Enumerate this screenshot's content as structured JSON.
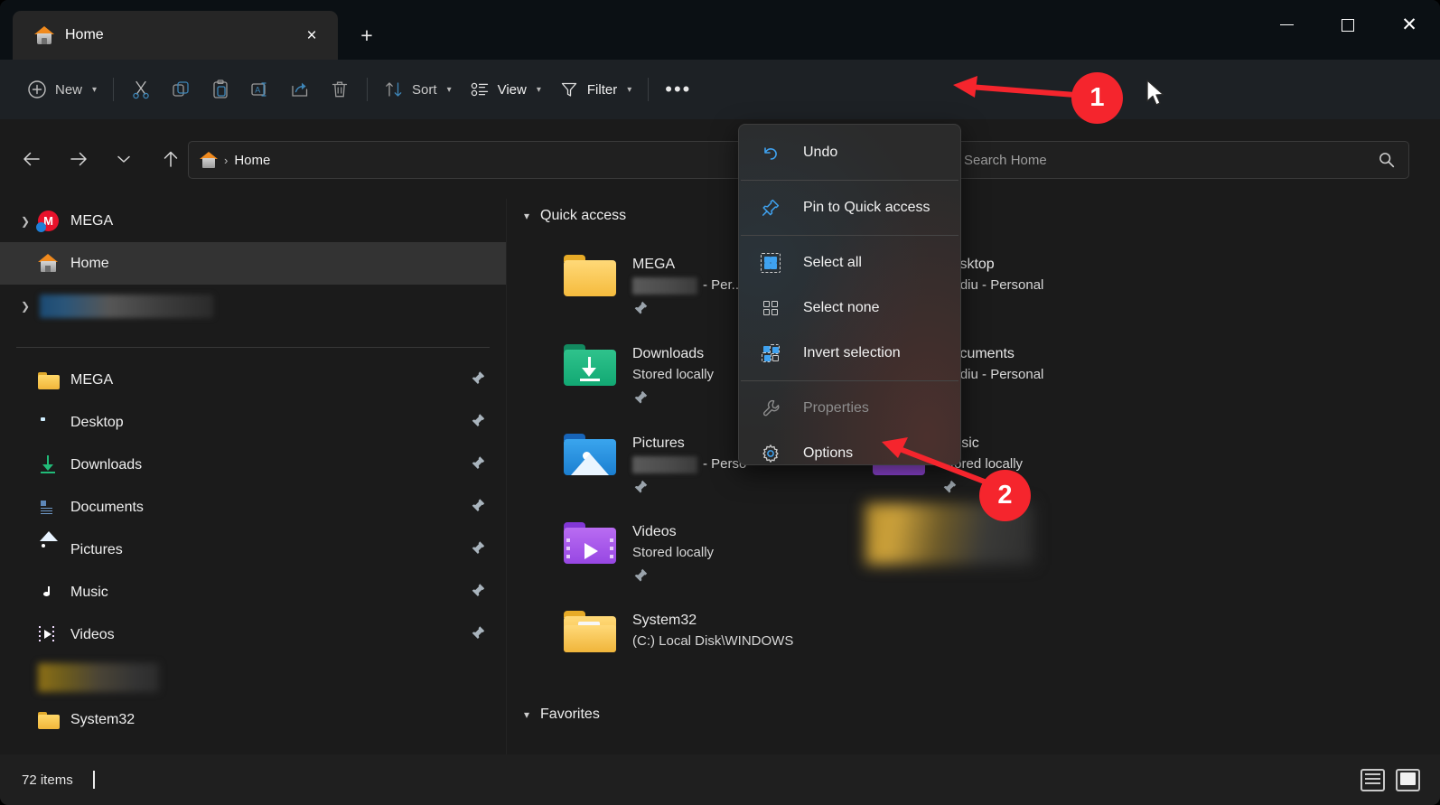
{
  "window": {
    "title": "Home",
    "controls": {
      "minimize": "minimize-button",
      "maximize": "maximize-button",
      "close": "close-button"
    },
    "new_tab_label": "+",
    "tab_close_label": "×"
  },
  "toolbar": {
    "new_label": "New",
    "cut_label": "Cut",
    "copy_label": "Copy",
    "paste_label": "Paste",
    "rename_label": "Rename",
    "share_label": "Share",
    "delete_label": "Delete",
    "sort_label": "Sort",
    "view_label": "View",
    "filter_label": "Filter",
    "more_label": "•••"
  },
  "addressbar": {
    "back": "Back",
    "forward": "Forward",
    "recent": "Recent locations",
    "up": "Up to parent",
    "breadcrumb_root": "Home",
    "breadcrumb_separator": "›"
  },
  "search": {
    "placeholder": "Search Home"
  },
  "sidebar": {
    "tree": [
      {
        "label": "MEGA",
        "icon": "mega-icon",
        "expandable": true,
        "selected": false
      },
      {
        "label": "Home",
        "icon": "home-icon",
        "expandable": false,
        "selected": true
      },
      {
        "label": "",
        "icon": "blurred-account-icon",
        "expandable": true,
        "selected": false,
        "blurred": true
      }
    ],
    "pinned": [
      {
        "label": "MEGA",
        "icon": "folder-icon",
        "pinned": true
      },
      {
        "label": "Desktop",
        "icon": "desktop-icon",
        "pinned": true
      },
      {
        "label": "Downloads",
        "icon": "downloads-icon",
        "pinned": true
      },
      {
        "label": "Documents",
        "icon": "documents-icon",
        "pinned": true
      },
      {
        "label": "Pictures",
        "icon": "pictures-icon",
        "pinned": true
      },
      {
        "label": "Music",
        "icon": "music-icon",
        "pinned": true
      },
      {
        "label": "Videos",
        "icon": "videos-icon",
        "pinned": true
      },
      {
        "label": "",
        "icon": "blurred-folder-icon",
        "pinned": false,
        "blurred": true
      },
      {
        "label": "System32",
        "icon": "folder-icon",
        "pinned": false
      }
    ]
  },
  "content": {
    "groups": [
      {
        "label": "Quick access",
        "expanded": true
      },
      {
        "label": "Favorites",
        "expanded": true
      }
    ],
    "quick_access": [
      {
        "name": "MEGA",
        "subtitle": " - Per...\\",
        "subtitle_blurred": true,
        "icon": "folder-yellow-icon",
        "pinned": true
      },
      {
        "name": "Desktop",
        "subtitle": "...udiu - Personal",
        "icon": "folder-blue-icon",
        "pinned": true
      },
      {
        "name": "Downloads",
        "subtitle": "Stored locally",
        "icon": "folder-downloads-icon",
        "pinned": true
      },
      {
        "name": "Documents",
        "subtitle": "...udiu - Personal",
        "icon": "folder-documents-icon",
        "pinned": true
      },
      {
        "name": "Pictures",
        "subtitle": " - Perso",
        "subtitle_blurred": true,
        "icon": "folder-pictures-icon",
        "pinned": true
      },
      {
        "name": "Music",
        "subtitle": "Stored locally",
        "icon": "folder-music-icon",
        "pinned": true
      },
      {
        "name": "Videos",
        "subtitle": "Stored locally",
        "icon": "folder-videos-icon",
        "pinned": true
      },
      {
        "name": "System32",
        "subtitle": "(C:) Local Disk\\WINDOWS",
        "icon": "folder-system32-icon",
        "pinned": false
      }
    ]
  },
  "context_menu": {
    "items": [
      {
        "label": "Undo",
        "icon": "undo-icon",
        "disabled": false
      },
      {
        "label": "Pin to Quick access",
        "icon": "pin-icon",
        "disabled": false
      },
      {
        "label": "Select all",
        "icon": "select-all-icon",
        "disabled": false
      },
      {
        "label": "Select none",
        "icon": "select-none-icon",
        "disabled": false
      },
      {
        "label": "Invert selection",
        "icon": "invert-selection-icon",
        "disabled": false
      },
      {
        "label": "Properties",
        "icon": "wrench-icon",
        "disabled": true
      },
      {
        "label": "Options",
        "icon": "gear-icon",
        "disabled": false
      }
    ]
  },
  "statusbar": {
    "item_count": "72 items",
    "details_view_label": "Details view",
    "large_icons_view_label": "Large icons view"
  },
  "annotations": [
    {
      "number": "1",
      "target": "see-more-button"
    },
    {
      "number": "2",
      "target": "options-menu-item"
    }
  ],
  "colors": {
    "accent_red": "#f5252d",
    "menu_background": "#2b2b2b",
    "window_background": "#1b1b1b",
    "toolbar_background": "#1d2125",
    "icon_blue": "#3fa2f0"
  }
}
